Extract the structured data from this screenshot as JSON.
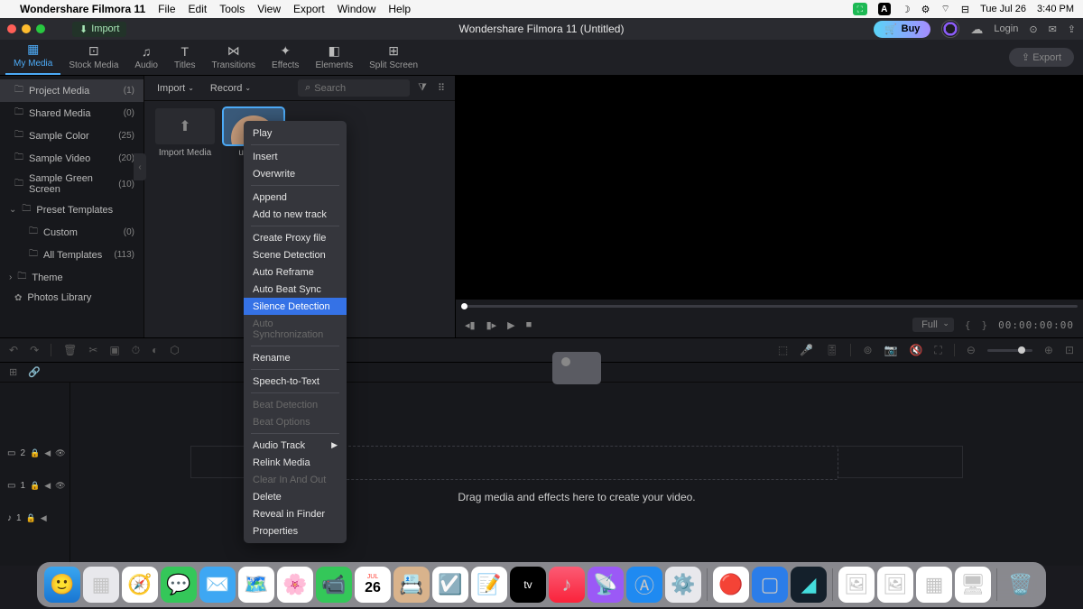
{
  "mac_menubar": {
    "app_name": "Wondershare Filmora 11",
    "menus": [
      "File",
      "Edit",
      "Tools",
      "View",
      "Export",
      "Window",
      "Help"
    ],
    "date": "Tue Jul 26",
    "time": "3:40 PM"
  },
  "title_bar": {
    "import_label": "Import",
    "title": "Wondershare Filmora 11 (Untitled)",
    "buy_label": "Buy",
    "login_label": "Login"
  },
  "top_tabs": {
    "items": [
      "My Media",
      "Stock Media",
      "Audio",
      "Titles",
      "Transitions",
      "Effects",
      "Elements",
      "Split Screen"
    ],
    "export_label": "Export"
  },
  "sidebar": {
    "items": [
      {
        "label": "Project Media",
        "count": "(1)",
        "active": true
      },
      {
        "label": "Shared Media",
        "count": "(0)"
      },
      {
        "label": "Sample Color",
        "count": "(25)"
      },
      {
        "label": "Sample Video",
        "count": "(20)"
      },
      {
        "label": "Sample Green Screen",
        "count": "(10)"
      },
      {
        "label": "Preset Templates",
        "count": "",
        "expandable": true
      },
      {
        "label": "Custom",
        "count": "(0)",
        "child": true
      },
      {
        "label": "All Templates",
        "count": "(113)",
        "child": true
      },
      {
        "label": "Theme",
        "count": "",
        "expandable": true,
        "collapsed": true
      },
      {
        "label": "Photos Library",
        "count": "",
        "icon": "flower"
      }
    ]
  },
  "media_toolbar": {
    "import_dd": "Import",
    "record_dd": "Record",
    "search_placeholder": "Search"
  },
  "media_cells": [
    {
      "label": "Import Media"
    },
    {
      "label": "user gu",
      "selected": true
    }
  ],
  "context_menu": {
    "groups": [
      [
        "Play"
      ],
      [
        "Insert",
        "Overwrite"
      ],
      [
        "Append",
        "Add to new track"
      ],
      [
        "Create Proxy file",
        "Scene Detection",
        "Auto Reframe",
        "Auto Beat Sync",
        {
          "label": "Silence Detection",
          "highlighted": true
        },
        {
          "label": "Auto Synchronization",
          "disabled": true
        }
      ],
      [
        "Rename"
      ],
      [
        "Speech-to-Text"
      ],
      [
        {
          "label": "Beat Detection",
          "disabled": true
        },
        {
          "label": "Beat Options",
          "disabled": true
        }
      ],
      [
        {
          "label": "Audio Track",
          "submenu": true
        },
        "Relink Media",
        {
          "label": "Clear In And Out",
          "disabled": true
        },
        "Delete",
        "Reveal in Finder",
        "Properties"
      ]
    ]
  },
  "preview": {
    "quality": "Full",
    "timecode": "00:00:00:00"
  },
  "timeline": {
    "tracks": [
      {
        "label": "2",
        "type": "video"
      },
      {
        "label": "1",
        "type": "video"
      },
      {
        "label": "1",
        "type": "audio"
      }
    ],
    "drop_text": "Drag media and effects here to create your video."
  }
}
